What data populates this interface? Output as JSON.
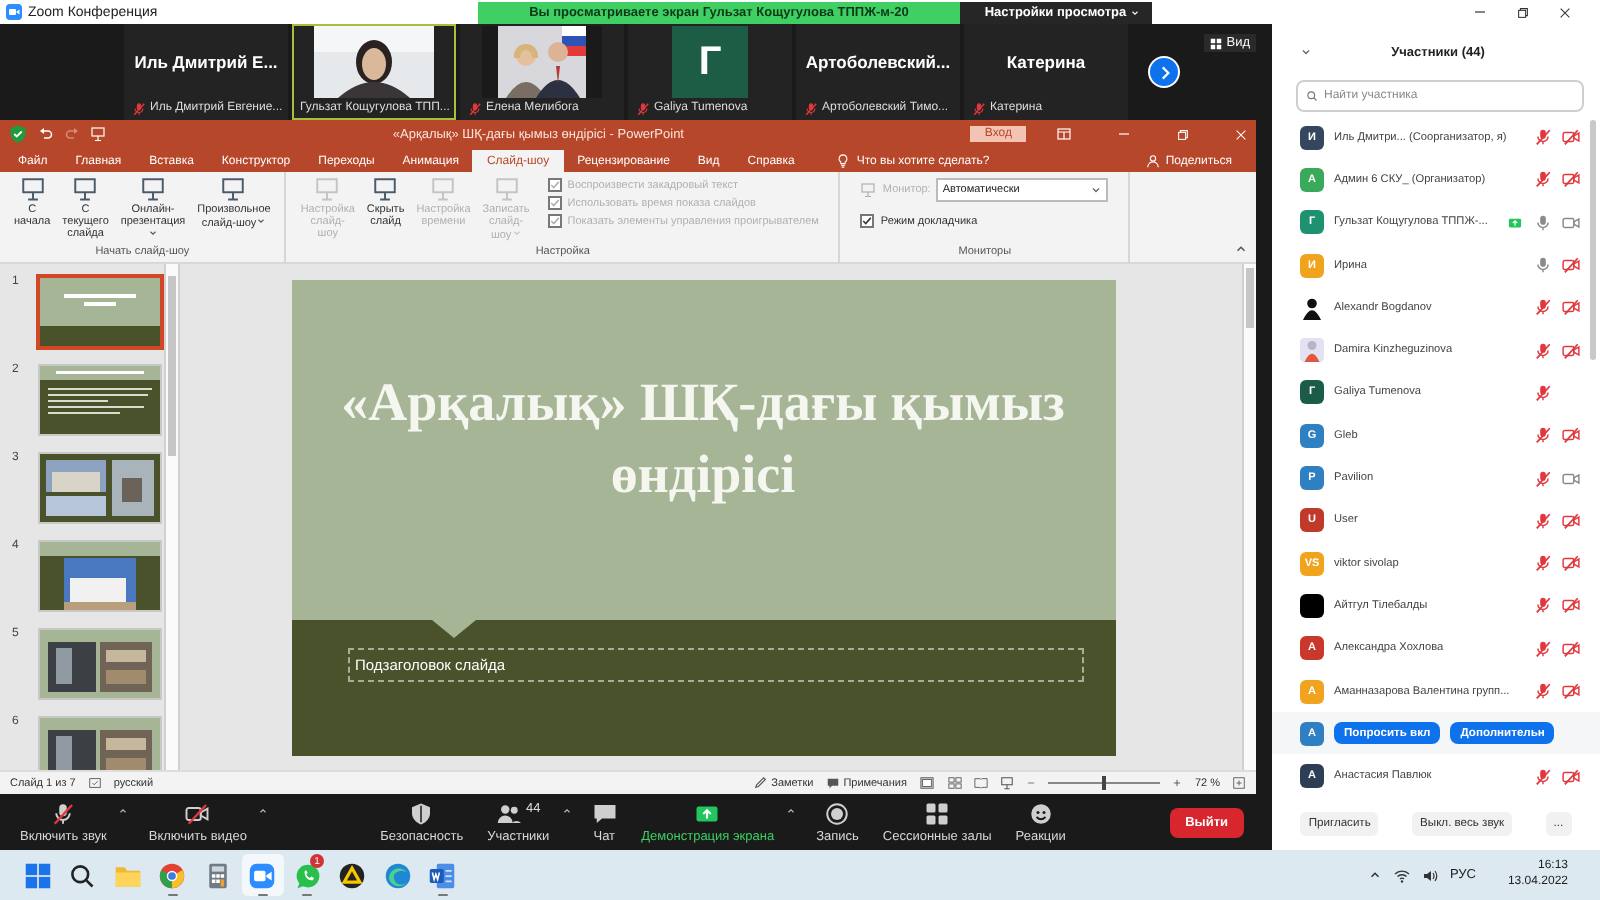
{
  "window": {
    "title": "Zoom Конференция"
  },
  "share_banner": {
    "text": "Вы просматриваете экран Гульзат Кощугулова ТППЖ-м-20",
    "menu": "Настройки просмотра"
  },
  "video_strip": {
    "tiles": [
      {
        "kind": "name",
        "display": "Иль Дмитрий Е...",
        "label": "Иль Дмитрий Евгение...",
        "muted": true,
        "speaking": false
      },
      {
        "kind": "video",
        "label": "Гульзат Кощугулова ТПП...",
        "muted": false,
        "speaking": true
      },
      {
        "kind": "video",
        "label": "Елена Мелибога",
        "muted": true,
        "speaking": false
      },
      {
        "kind": "avatar",
        "display": "Г",
        "color": "#1d5c45",
        "label": "Galiya Tumenova",
        "muted": true,
        "speaking": false
      },
      {
        "kind": "name",
        "display": "Артоболевский...",
        "label": "Артоболевский Тимо...",
        "muted": true,
        "speaking": false
      },
      {
        "kind": "name",
        "display": "Катерина",
        "label": "Катерина",
        "muted": true,
        "speaking": false
      }
    ],
    "view_button": "Вид"
  },
  "powerpoint": {
    "title": "«Арқалық» ШҚ-дағы қымыз өндірісі - PowerPoint",
    "signin": "Вход",
    "tabs": [
      {
        "label": "Файл",
        "selected": false
      },
      {
        "label": "Главная",
        "selected": false
      },
      {
        "label": "Вставка",
        "selected": false
      },
      {
        "label": "Конструктор",
        "selected": false
      },
      {
        "label": "Переходы",
        "selected": false
      },
      {
        "label": "Анимация",
        "selected": false
      },
      {
        "label": "Слайд-шоу",
        "selected": true
      },
      {
        "label": "Рецензирование",
        "selected": false
      },
      {
        "label": "Вид",
        "selected": false
      },
      {
        "label": "Справка",
        "selected": false
      }
    ],
    "tell_me": "Что вы хотите сделать?",
    "share": "Поделиться",
    "ribbon": [
      {
        "label": "Начать слайд-шоу",
        "items": [
          {
            "kind": "button",
            "label": "С начала",
            "disabled": false,
            "dropdown": false
          },
          {
            "kind": "button",
            "label": "С текущего слайда",
            "disabled": false,
            "dropdown": false
          },
          {
            "kind": "button",
            "label": "Онлайн-презентация",
            "disabled": false,
            "dropdown": true
          },
          {
            "kind": "button",
            "label": "Произвольное слайд-шоу",
            "disabled": false,
            "dropdown": true
          }
        ]
      },
      {
        "label": "Настройка",
        "items": [
          {
            "kind": "button",
            "label": "Настройка слайд-шоу",
            "disabled": true,
            "dropdown": false
          },
          {
            "kind": "button",
            "label": "Скрыть слайд",
            "disabled": false,
            "dropdown": false
          },
          {
            "kind": "button",
            "label": "Настройка времени",
            "disabled": true,
            "dropdown": false
          },
          {
            "kind": "button",
            "label": "Записать слайд-шоу",
            "disabled": true,
            "dropdown": true
          },
          {
            "kind": "check",
            "label": "Воспроизвести закадровый текст",
            "checked": true,
            "disabled": true
          },
          {
            "kind": "check",
            "label": "Использовать время показа слайдов",
            "checked": true,
            "disabled": true
          },
          {
            "kind": "check",
            "label": "Показать элементы управления проигрывателем",
            "checked": true,
            "disabled": true
          }
        ]
      },
      {
        "label": "Мониторы",
        "items": [
          {
            "kind": "select",
            "label": "Монитор:",
            "value": "Автоматически",
            "disabled": true
          },
          {
            "kind": "check",
            "label": "Режим докладчика",
            "checked": true,
            "disabled": false
          }
        ]
      }
    ],
    "thumbnails": [
      {
        "number": "1",
        "kind": "title",
        "selected": true
      },
      {
        "number": "2",
        "kind": "text",
        "selected": false
      },
      {
        "number": "3",
        "kind": "photos",
        "selected": false
      },
      {
        "number": "4",
        "selected": false
      },
      {
        "number": "5",
        "kind": "gallery",
        "selected": false
      },
      {
        "number": "6",
        "kind": "gallery",
        "selected": false
      }
    ],
    "slide": {
      "title": "«Арқалық» ШҚ-дағы қымыз өндірісі",
      "subtitle": "Подзаголовок слайда"
    },
    "status_bar": {
      "slide": "Слайд 1 из 7",
      "language": "русский",
      "notes": "Заметки",
      "comments": "Примечания",
      "zoom": "72 %",
      "level": 0.5
    }
  },
  "toolbar": {
    "items": [
      {
        "kind": "mic",
        "label": "Включить звук",
        "caret": true,
        "active": false
      },
      {
        "kind": "video",
        "label": "Включить видео",
        "caret": true,
        "active": false
      },
      {
        "kind": "security",
        "label": "Безопасность",
        "caret": false,
        "active": false
      },
      {
        "kind": "participants",
        "label": "Участники",
        "count": "44",
        "caret": true,
        "active": false
      },
      {
        "kind": "chat",
        "label": "Чат",
        "caret": false,
        "active": false
      },
      {
        "kind": "share",
        "label": "Демонстрация экрана",
        "caret": true,
        "active": true
      },
      {
        "kind": "record",
        "label": "Запись",
        "caret": false,
        "active": false
      },
      {
        "kind": "breakout",
        "label": "Сессионные залы",
        "caret": false,
        "active": false
      },
      {
        "kind": "reactions",
        "label": "Реакции",
        "caret": false,
        "active": false
      }
    ],
    "leave": "Выйти"
  },
  "participants_panel": {
    "title": "Участники (44)",
    "search": {
      "placeholder": "Найти участника"
    },
    "participants": [
      {
        "kind": "letter",
        "initials": "И",
        "color": "#35475f",
        "name": "Иль Дмитри... (Соорганизатор, я)",
        "muted": true,
        "video_off": true,
        "no_camera": false,
        "sharing": false
      },
      {
        "kind": "letter",
        "initials": "А",
        "color": "#3aaa5a",
        "name": "Админ 6 СКУ_ (Организатор)",
        "muted": true,
        "video_off": true,
        "no_camera": false,
        "sharing": false
      },
      {
        "kind": "letter",
        "initials": "Г",
        "color": "#1e9170",
        "name": "Гульзат Кощугулова ТППЖ-...",
        "muted": false,
        "video_off": false,
        "no_camera": false,
        "sharing": true
      },
      {
        "kind": "letter",
        "initials": "И",
        "color": "#f0a31c",
        "name": "Ирина",
        "muted": false,
        "video_off": true,
        "no_camera": false,
        "sharing": false
      },
      {
        "name": "Alexandr Bogdanov",
        "muted": true,
        "video_off": true,
        "no_camera": false,
        "sharing": false
      },
      {
        "name": "Damira Kinzheguzinova",
        "muted": true,
        "video_off": true,
        "no_camera": false,
        "sharing": false
      },
      {
        "kind": "letter",
        "initials": "Г",
        "color": "#1c5b47",
        "name": "Galiya Tumenova",
        "muted": true,
        "no_camera": true,
        "sharing": false
      },
      {
        "kind": "letter",
        "initials": "G",
        "color": "#2f80c2",
        "name": "Gleb",
        "muted": true,
        "video_off": true,
        "no_camera": false,
        "sharing": false
      },
      {
        "kind": "letter",
        "initials": "P",
        "color": "#2f80c2",
        "name": "Pavilion",
        "muted": true,
        "video_off": false,
        "no_camera": false,
        "sharing": false
      },
      {
        "kind": "letter",
        "initials": "U",
        "color": "#c0392b",
        "name": "User",
        "muted": true,
        "video_off": true,
        "no_camera": false,
        "sharing": false
      },
      {
        "kind": "letter",
        "initials": "VS",
        "color": "#f0a31c",
        "name": "viktor sivolap",
        "muted": true,
        "video_off": true,
        "no_camera": false,
        "sharing": false
      },
      {
        "kind": "letter",
        "color": "#000000",
        "name": "Айтгул Тілебалды",
        "muted": true,
        "video_off": true,
        "no_camera": false,
        "sharing": false
      },
      {
        "kind": "letter",
        "initials": "А",
        "color": "#c9392b",
        "name": "Александра Хохлова",
        "muted": true,
        "video_off": true,
        "no_camera": false,
        "sharing": false
      },
      {
        "kind": "letter",
        "initials": "А",
        "color": "#f0a31c",
        "name": "Аманназарова Валентина групп...",
        "muted": true,
        "video_off": true,
        "no_camera": false,
        "sharing": false
      },
      {
        "kind": "hover",
        "initials": "А",
        "color": "#2f80c2",
        "actions": [
          "Попросить вкл",
          "Дополнительн"
        ]
      },
      {
        "kind": "letter",
        "initials": "А",
        "color": "#2e3e57",
        "name": "Анастасия Павлюк",
        "muted": true,
        "video_off": true,
        "no_camera": false,
        "sharing": false
      }
    ],
    "footer": [
      "Пригласить",
      "Выкл. весь звук",
      "..."
    ]
  },
  "taskbar": {
    "apps": [
      {
        "kind": "start",
        "selected": false,
        "running": false
      },
      {
        "kind": "search",
        "selected": false,
        "running": false
      },
      {
        "kind": "folder",
        "selected": false,
        "running": false
      },
      {
        "kind": "chrome",
        "selected": false,
        "running": true
      },
      {
        "kind": "calculator",
        "selected": false,
        "running": false
      },
      {
        "kind": "zoom",
        "selected": true,
        "running": true
      },
      {
        "kind": "whatsapp",
        "selected": false,
        "running": true,
        "badge": "1"
      },
      {
        "kind": "triangle",
        "selected": false,
        "running": false
      },
      {
        "kind": "edge",
        "selected": false,
        "running": false
      },
      {
        "kind": "word",
        "selected": false,
        "running": true
      }
    ],
    "tray": {
      "language": "РУС",
      "time": "16:13",
      "date": "13.04.2022"
    }
  }
}
